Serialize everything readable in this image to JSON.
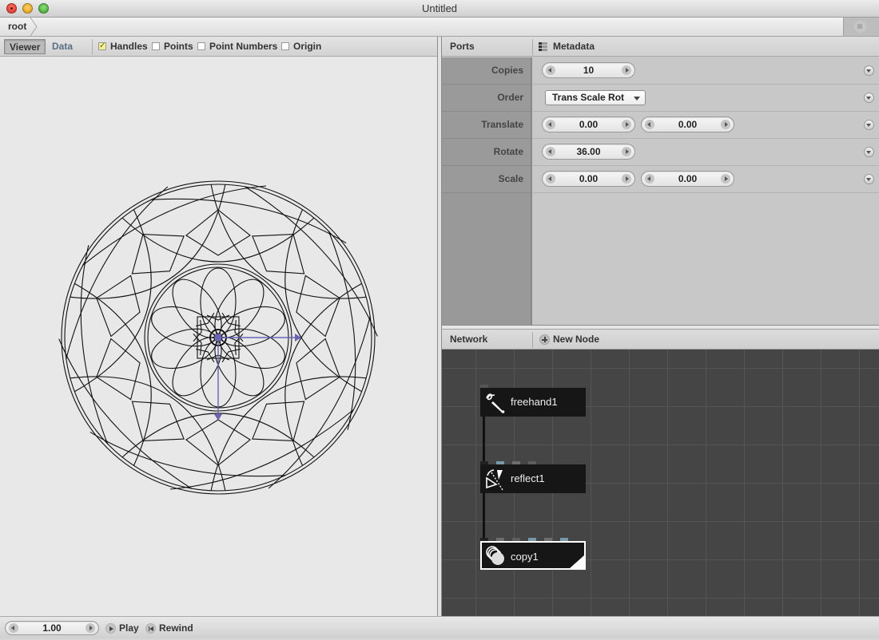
{
  "window": {
    "title": "Untitled"
  },
  "pathbar": {
    "crumbs": [
      "root"
    ]
  },
  "viewer": {
    "tabs": [
      {
        "label": "Viewer",
        "active": true
      },
      {
        "label": "Data",
        "active": false
      }
    ],
    "checkboxes": [
      {
        "label": "Handles",
        "checked": true
      },
      {
        "label": "Points",
        "checked": false
      },
      {
        "label": "Point Numbers",
        "checked": false
      },
      {
        "label": "Origin",
        "checked": false
      }
    ],
    "handle_color": "#6b63b5",
    "stroke_color": "#111111",
    "canvas_bg": "#e8e8e8",
    "geometry_copies": 10,
    "geometry_rotate_deg": 36
  },
  "ports": {
    "header": {
      "ports_label": "Ports",
      "metadata_label": "Metadata"
    },
    "rows": [
      {
        "label": "Copies",
        "type": "stepper",
        "values": [
          "10"
        ]
      },
      {
        "label": "Order",
        "type": "dropdown",
        "values": [
          "Trans Scale Rot"
        ]
      },
      {
        "label": "Translate",
        "type": "stepper",
        "values": [
          "0.00",
          "0.00"
        ]
      },
      {
        "label": "Rotate",
        "type": "stepper",
        "values": [
          "36.00"
        ]
      },
      {
        "label": "Scale",
        "type": "stepper",
        "values": [
          "0.00",
          "0.00"
        ]
      }
    ]
  },
  "network": {
    "header": {
      "label": "Network",
      "new_node_label": "New Node"
    },
    "bg_color": "#454545",
    "nodes": [
      {
        "name": "freehand1",
        "icon": "freehand-icon",
        "selected": false
      },
      {
        "name": "reflect1",
        "icon": "reflect-icon",
        "selected": false
      },
      {
        "name": "copy1",
        "icon": "copy-icon",
        "selected": true
      }
    ],
    "port_colors": {
      "active": "#7799aa",
      "inactive": "#6e6e6e"
    }
  },
  "bottombar": {
    "frame_value": "1.00",
    "play_label": "Play",
    "rewind_label": "Rewind"
  }
}
